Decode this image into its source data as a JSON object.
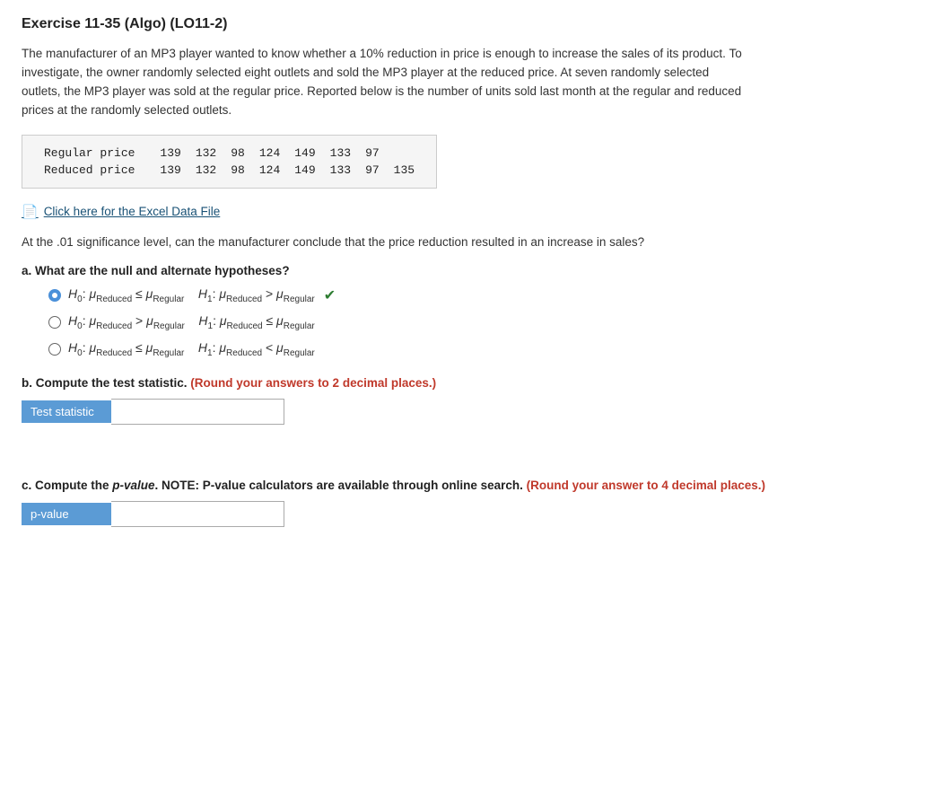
{
  "page": {
    "title": "Exercise 11-35 (Algo) (LO11-2)",
    "description_lines": [
      "The manufacturer of an MP3 player wanted to know whether a 10% reduction in price is enough to increase the sales of its product. To",
      "investigate, the owner randomly selected eight outlets and sold the MP3 player at the reduced price. At seven randomly selected",
      "outlets, the MP3 player was sold at the regular price. Reported below is the number of units sold last month at the regular and reduced",
      "prices at the randomly selected outlets."
    ],
    "table": {
      "rows": [
        {
          "label": "Regular price",
          "values": [
            "139",
            "132",
            "98",
            "124",
            "149",
            "133",
            "97",
            ""
          ]
        },
        {
          "label": "Reduced price",
          "values": [
            "139",
            "132",
            "98",
            "124",
            "149",
            "133",
            "97",
            "135"
          ]
        }
      ]
    },
    "excel_link": "Click here for the Excel Data File",
    "significance_question": "At the .01 significance level, can the manufacturer conclude that the price reduction resulted in an increase in sales?",
    "part_a": {
      "label": "a. What are the null and alternate hypotheses?",
      "options": [
        {
          "id": "option1",
          "selected": true,
          "text_html": "H₀: μReduced ≤ μRegular   H₁: μReduced > μRegular",
          "has_check": true
        },
        {
          "id": "option2",
          "selected": false,
          "text_html": "H₀: μReduced > μRegular   H₁: μReduced ≤ μRegular",
          "has_check": false
        },
        {
          "id": "option3",
          "selected": false,
          "text_html": "H₀: μReduced ≤ μRegular   H₁: μReduced < μRegular",
          "has_check": false
        }
      ]
    },
    "part_b": {
      "label": "b. Compute the test statistic.",
      "instruction": "(Round your answers to 2 decimal places.)",
      "input_label": "Test statistic",
      "input_value": ""
    },
    "part_c": {
      "label": "c. Compute the",
      "p_value_text": "p-value",
      "after_pvalue": ". NOTE: P-value calculators are available through online search.",
      "instruction": "(Round your answer to 4 decimal places.)",
      "input_label": "p-value",
      "input_value": ""
    }
  }
}
